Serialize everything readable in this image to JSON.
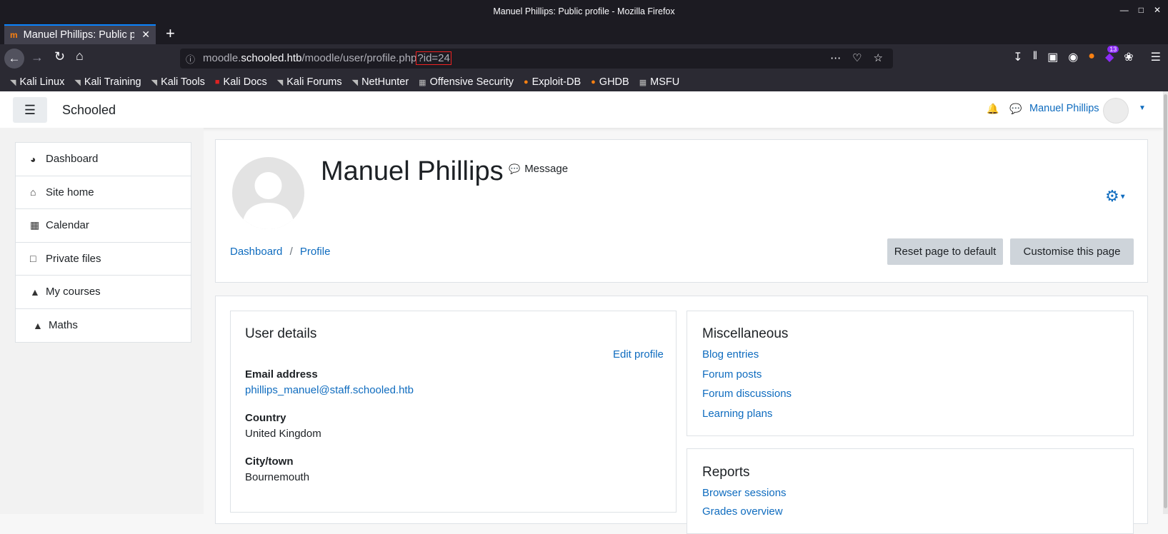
{
  "window": {
    "title": "Manuel Phillips: Public profile - Mozilla Firefox"
  },
  "tab": {
    "title": "Manuel Phillips: Public profile"
  },
  "urlbar": {
    "prefix": "moodle.",
    "host": "schooled.htb",
    "path": "/moodle/user/profile.php",
    "query": "?id=24"
  },
  "extensions": {
    "badge_count": "13"
  },
  "bookmarks": [
    "Kali Linux",
    "Kali Training",
    "Kali Tools",
    "Kali Docs",
    "Kali Forums",
    "NetHunter",
    "Offensive Security",
    "Exploit-DB",
    "GHDB",
    "MSFU"
  ],
  "site": {
    "name": "Schooled",
    "user": "Manuel Phillips"
  },
  "drawer": [
    "Dashboard",
    "Site home",
    "Calendar",
    "Private files",
    "My courses",
    "Maths"
  ],
  "profile": {
    "name": "Manuel Phillips",
    "message_label": "Message",
    "breadcrumb": [
      "Dashboard",
      "Profile"
    ],
    "reset_label": "Reset page to default",
    "customise_label": "Customise this page"
  },
  "user_details": {
    "title": "User details",
    "edit_label": "Edit profile",
    "email_label": "Email address",
    "email": "phillips_manuel@staff.schooled.htb",
    "country_label": "Country",
    "country": "United Kingdom",
    "city_label": "City/town",
    "city": "Bournemouth"
  },
  "misc": {
    "title": "Miscellaneous",
    "links": [
      "Blog entries",
      "Forum posts",
      "Forum discussions",
      "Learning plans"
    ]
  },
  "reports": {
    "title": "Reports",
    "links": [
      "Browser sessions",
      "Grades overview"
    ]
  },
  "colors": {
    "link": "#0f6cbf",
    "accent": "#0a84ff",
    "moodle_orange": "#f98012"
  }
}
